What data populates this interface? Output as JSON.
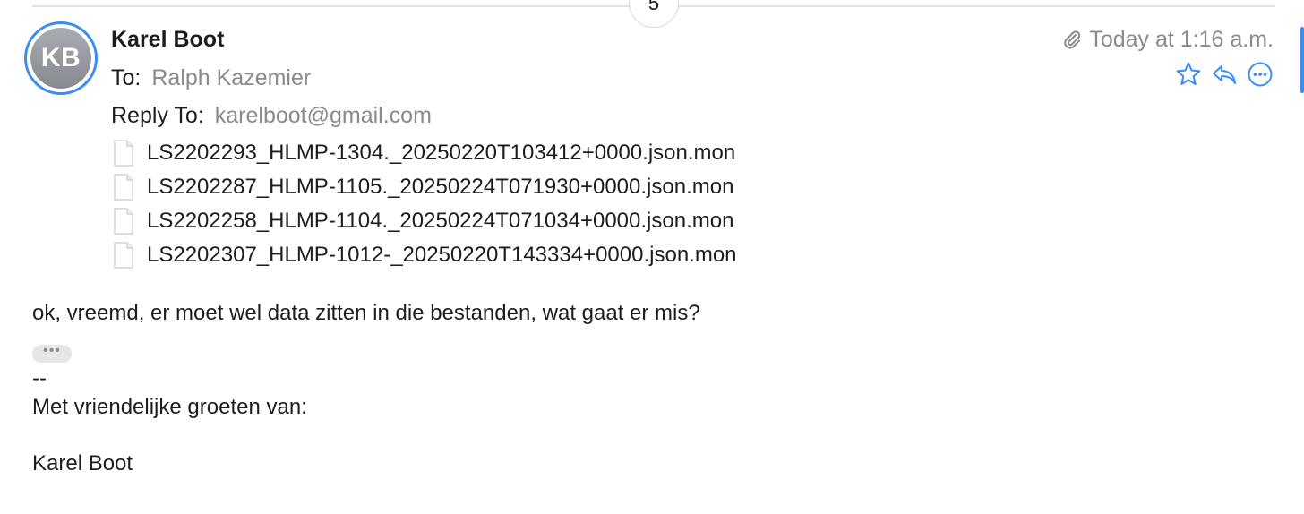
{
  "thread": {
    "message_count": "5"
  },
  "message": {
    "avatar_initials": "KB",
    "sender_name": "Karel Boot",
    "to_label": "To:",
    "to_value": "Ralph Kazemier",
    "reply_to_label": "Reply To:",
    "reply_to_value": "karelboot@gmail.com",
    "date": "Today at 1:16 a.m.",
    "attachments": [
      "LS2202293_HLMP-1304._20250220T103412+0000.json.mon",
      "LS2202287_HLMP-1105._20250224T071930+0000.json.mon",
      "LS2202258_HLMP-1104._20250224T071034+0000.json.mon",
      "LS2202307_HLMP-1012-_20250220T143334+0000.json.mon"
    ],
    "actions": [
      "star-icon",
      "reply-icon",
      "more-icon"
    ],
    "accent_color": "#3b8df2"
  },
  "body": {
    "text": "ok, vreemd, er moet wel data zitten in die bestanden, wat gaat er mis?",
    "quote_toggle": "•••",
    "signature_separator": "--",
    "signature_greeting": "Met vriendelijke groeten van:",
    "signature_name": "Karel Boot"
  }
}
